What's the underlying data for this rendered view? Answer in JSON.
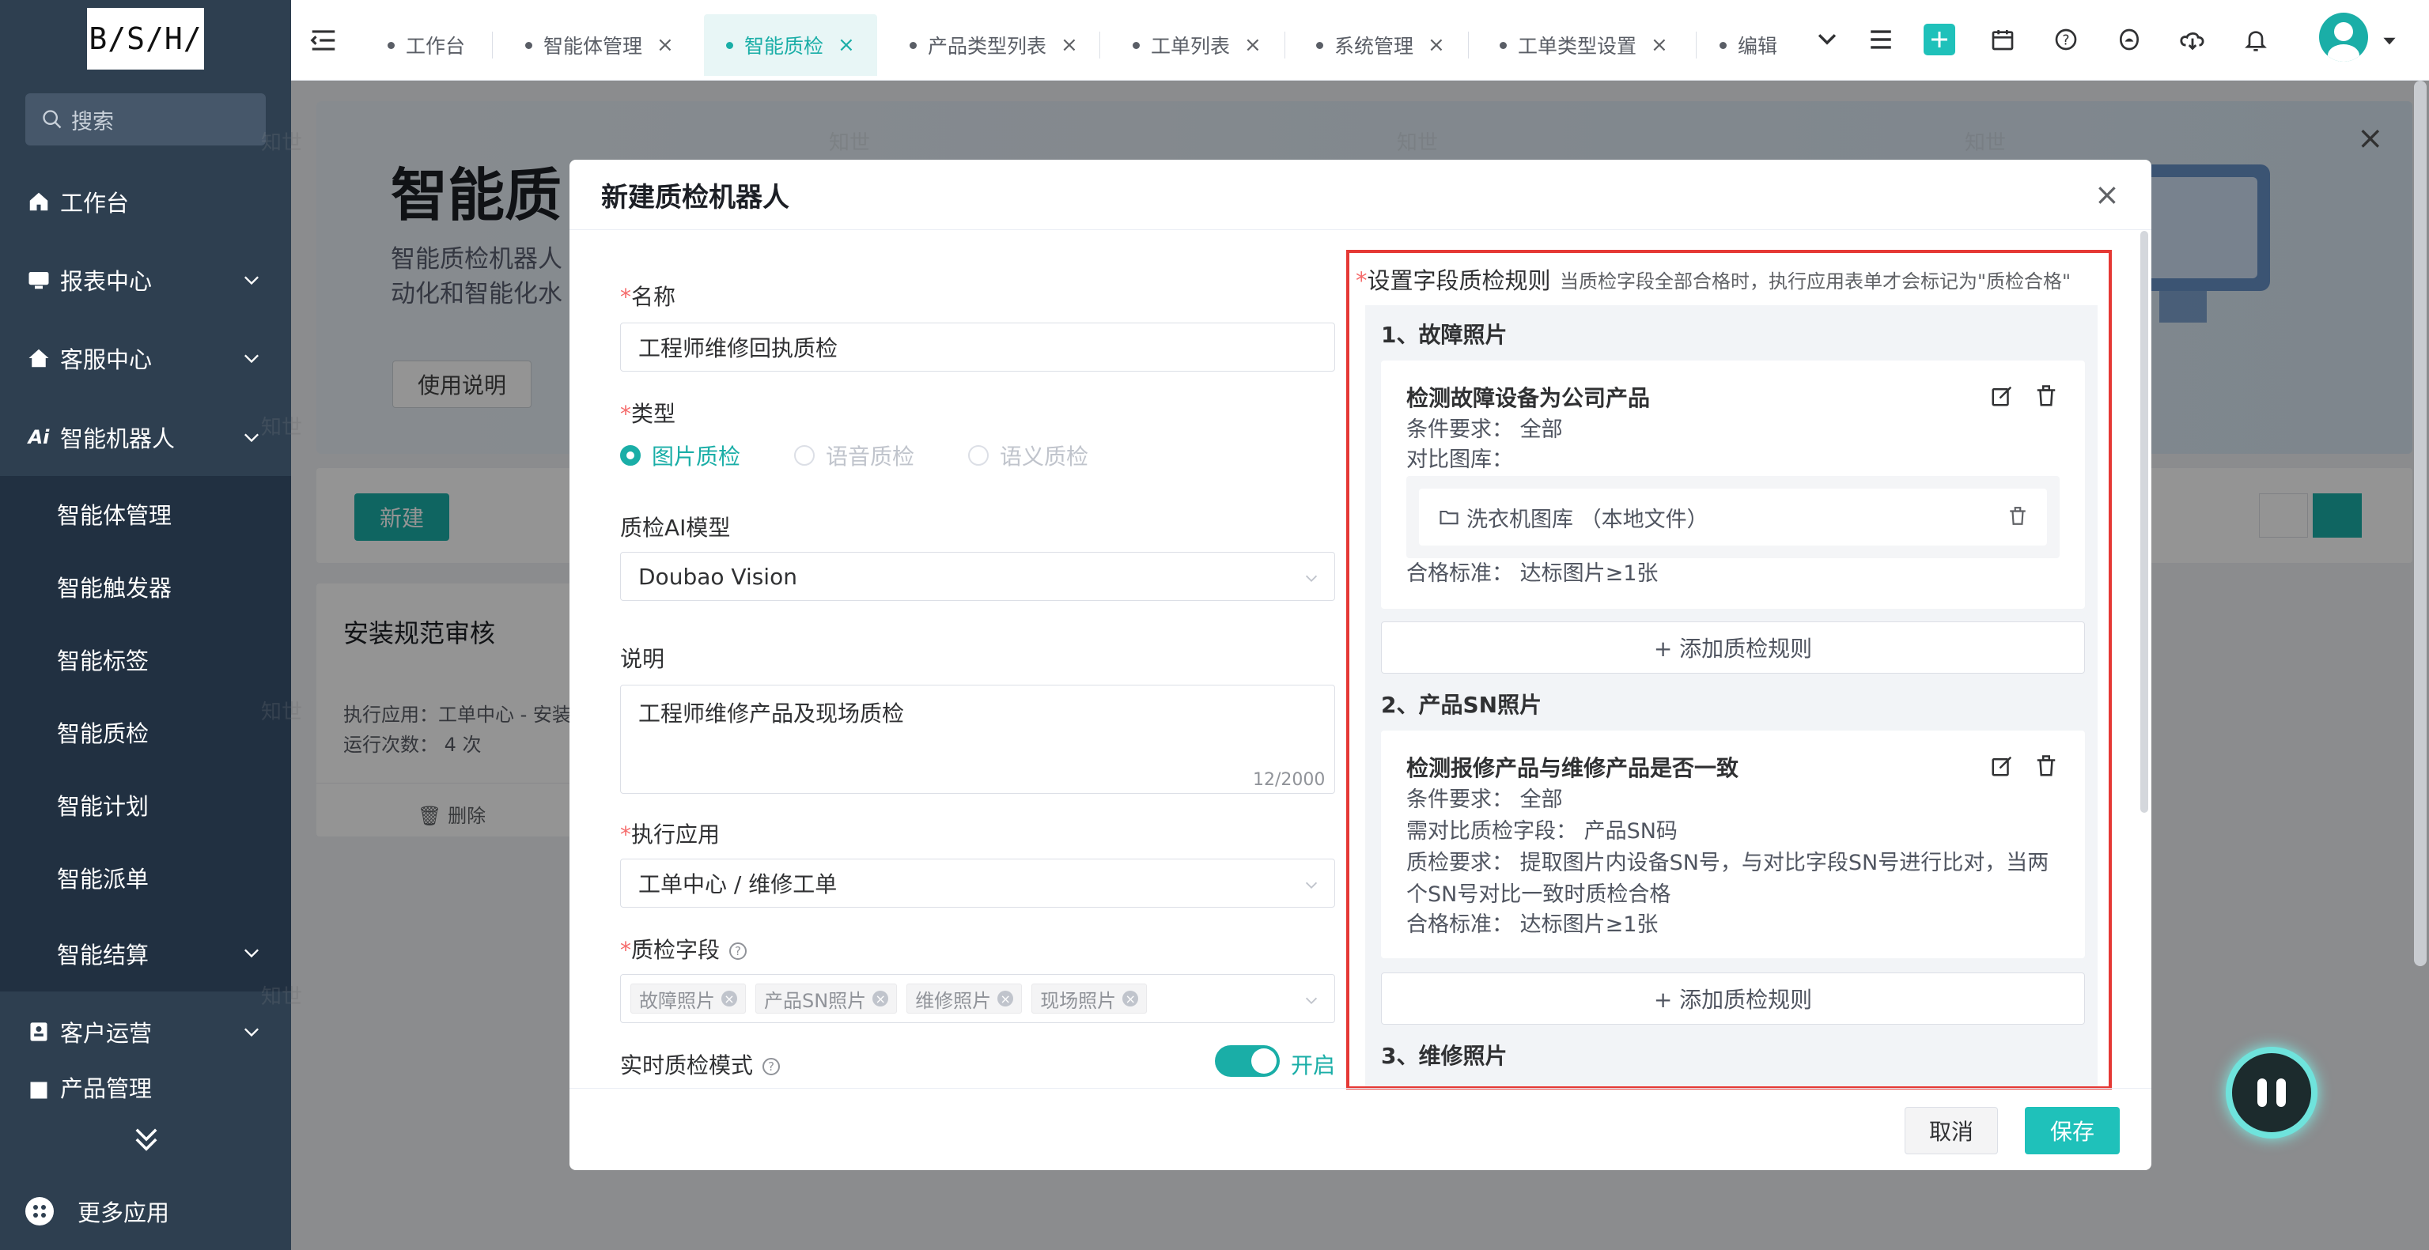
{
  "logo": "B/S/H/",
  "sidebar": {
    "search_placeholder": "搜索",
    "items": [
      {
        "label": "工作台"
      },
      {
        "label": "报表中心"
      },
      {
        "label": "客服中心"
      },
      {
        "label": "智能机器人"
      },
      {
        "label": "客户运营"
      },
      {
        "label": "产品管理"
      }
    ],
    "sub_items": [
      {
        "label": "智能体管理"
      },
      {
        "label": "智能触发器"
      },
      {
        "label": "智能标签"
      },
      {
        "label": "智能质检"
      },
      {
        "label": "智能计划"
      },
      {
        "label": "智能派单"
      },
      {
        "label": "智能结算"
      }
    ],
    "more_apps": "更多应用"
  },
  "tabs": [
    {
      "label": "工作台"
    },
    {
      "label": "智能体管理"
    },
    {
      "label": "智能质检"
    },
    {
      "label": "产品类型列表"
    },
    {
      "label": "工单列表"
    },
    {
      "label": "系统管理"
    },
    {
      "label": "工单类型设置"
    },
    {
      "label": "编辑"
    }
  ],
  "main": {
    "banner_title": "智能质",
    "banner_desc_1": "智能质检机器人",
    "banner_desc_2": "动化和智能化水",
    "usage_button": "使用说明",
    "new_button": "新建",
    "card": {
      "title": "安装规范审核",
      "exec_app": "执行应用：工单中心 - 安装",
      "runs": "运行次数：  4 次",
      "delete": "删除"
    },
    "watermark": "知世"
  },
  "dialog": {
    "title": "新建质检机器人",
    "name_label": "名称",
    "name_value": "工程师维修回执质检",
    "type_label": "类型",
    "type_options": [
      "图片质检",
      "语音质检",
      "语义质检"
    ],
    "model_label": "质检AI模型",
    "model_value": "Doubao Vision",
    "desc_label": "说明",
    "desc_value": "工程师维修产品及现场质检",
    "desc_counter": "12/2000",
    "app_label": "执行应用",
    "app_value": "工单中心 / 维修工单",
    "fields_label": "质检字段",
    "fields_tags": [
      "故障照片",
      "产品SN照片",
      "维修照片",
      "现场照片"
    ],
    "realtime_label": "实时质检模式",
    "realtime_state": "开启",
    "rules": {
      "title": "设置字段质检规则",
      "hint": "当质检字段全部合格时，执行应用表单才会标记为\"质检合格\"",
      "sections": [
        {
          "title": "1、故障照片",
          "rule_name": "检测故障设备为公司产品",
          "condition": "条件要求：  全部",
          "gallery_label": "对比图库：",
          "gallery_item": "洗衣机图库  （本地文件）",
          "standard": "合格标准：  达标图片≥1张"
        },
        {
          "title": "2、产品SN照片",
          "rule_name": "检测报修产品与维修产品是否一致",
          "condition": "条件要求：  全部",
          "compare_field": "需对比质检字段：  产品SN码",
          "requirement": "质检要求：  提取图片内设备SN号，与对比字段SN号进行比对，当两个SN号对比一致时质检合格",
          "standard": "合格标准：  达标图片≥1张"
        },
        {
          "title": "3、维修照片"
        }
      ],
      "add_rule": "+ 添加质检规则"
    },
    "cancel": "取消",
    "save": "保存"
  }
}
